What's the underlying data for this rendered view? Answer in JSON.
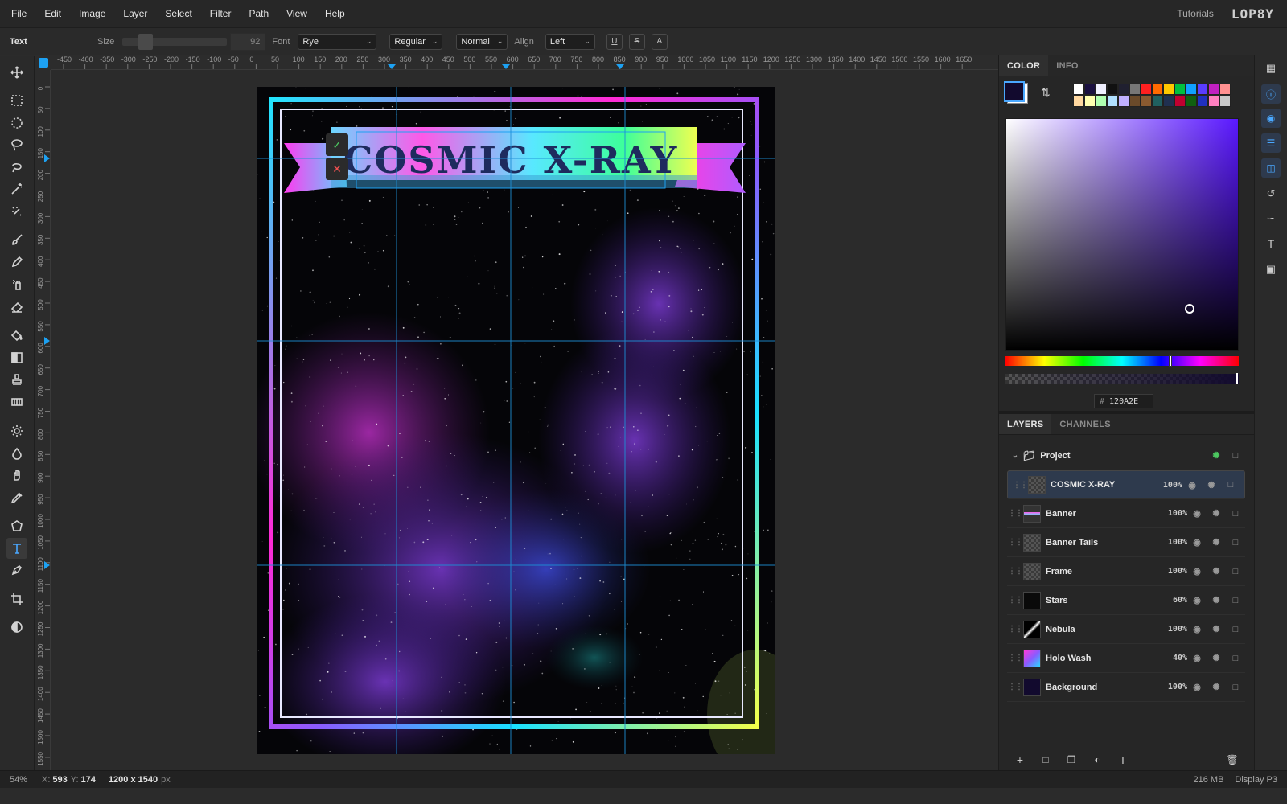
{
  "menu": [
    "File",
    "Edit",
    "Image",
    "Layer",
    "Select",
    "Filter",
    "Path",
    "View",
    "Help"
  ],
  "menu_right": {
    "tutorials": "Tutorials",
    "logo": "LOP8Y"
  },
  "options": {
    "tool_name": "Text",
    "size_label": "Size",
    "size_value": "92",
    "font_label": "Font",
    "font_value": "Rye",
    "style_value": "Regular",
    "blend_value": "Normal",
    "align_label": "Align",
    "align_value": "Left",
    "underline": "U",
    "strike": "S",
    "case": "A"
  },
  "ruler_h": [
    "-450",
    "-400",
    "-350",
    "-300",
    "-250",
    "-200",
    "-150",
    "-100",
    "-50",
    "0",
    "50",
    "100",
    "150",
    "200",
    "250",
    "300",
    "350",
    "400",
    "450",
    "500",
    "550",
    "600",
    "650",
    "700",
    "750",
    "800",
    "850",
    "900",
    "950",
    "1000",
    "1050",
    "1100",
    "1150",
    "1200",
    "1250",
    "1300",
    "1350",
    "1400",
    "1450",
    "1500",
    "1550",
    "1600",
    "1650"
  ],
  "ruler_v": [
    "0",
    "50",
    "100",
    "150",
    "200",
    "250",
    "300",
    "350",
    "400",
    "450",
    "500",
    "550",
    "600",
    "650",
    "700",
    "750",
    "800",
    "850",
    "900",
    "950",
    "1000",
    "1050",
    "1100",
    "1150",
    "1200",
    "1250",
    "1300",
    "1350",
    "1400",
    "1450",
    "1500",
    "1550"
  ],
  "canvas": {
    "title_text": "COSMIC X-RAY",
    "confirm_icon": "check-icon",
    "cancel_icon": "close-icon"
  },
  "color_panel": {
    "tabs": [
      "COLOR",
      "INFO"
    ],
    "foreground": "#120A2E",
    "background": "#FFFFFF",
    "hex_label": "#",
    "hex_value": "120A2E",
    "swatches_row1": [
      "#ffffff",
      "#1a1040",
      "#f0f0ff",
      "#111111",
      "#202030",
      "#777777",
      "#ff2020",
      "#ff6a00",
      "#ffc800",
      "#00c040",
      "#10a0ff",
      "#5a3cff",
      "#c020c0",
      "#ff9090"
    ],
    "swatches_row2": [
      "#ffd8a0",
      "#ffffb0",
      "#b0ffb0",
      "#b0e0ff",
      "#c0b0ff",
      "#6a4a2a",
      "#8a5a30",
      "#206060",
      "#203050",
      "#c00030",
      "#106010",
      "#2030c0",
      "#ff80c0",
      "#c8c8c8"
    ]
  },
  "layers_panel": {
    "tabs": [
      "LAYERS",
      "CHANNELS"
    ],
    "group": "Project",
    "layers": [
      {
        "name": "COSMIC X-RAY",
        "opacity": "100%"
      },
      {
        "name": "Banner",
        "opacity": "100%"
      },
      {
        "name": "Banner Tails",
        "opacity": "100%"
      },
      {
        "name": "Frame",
        "opacity": "100%"
      },
      {
        "name": "Stars",
        "opacity": "60%"
      },
      {
        "name": "Nebula",
        "opacity": "100%"
      },
      {
        "name": "Holo Wash",
        "opacity": "40%"
      },
      {
        "name": "Background",
        "opacity": "100%"
      }
    ]
  },
  "status": {
    "zoom": "54%",
    "x_label": "X:",
    "x": "593",
    "y_label": "Y:",
    "y": "174",
    "doc_size": "1200 x 1540",
    "doc_unit": "px",
    "memory": "216 MB",
    "profile": "Display P3"
  }
}
